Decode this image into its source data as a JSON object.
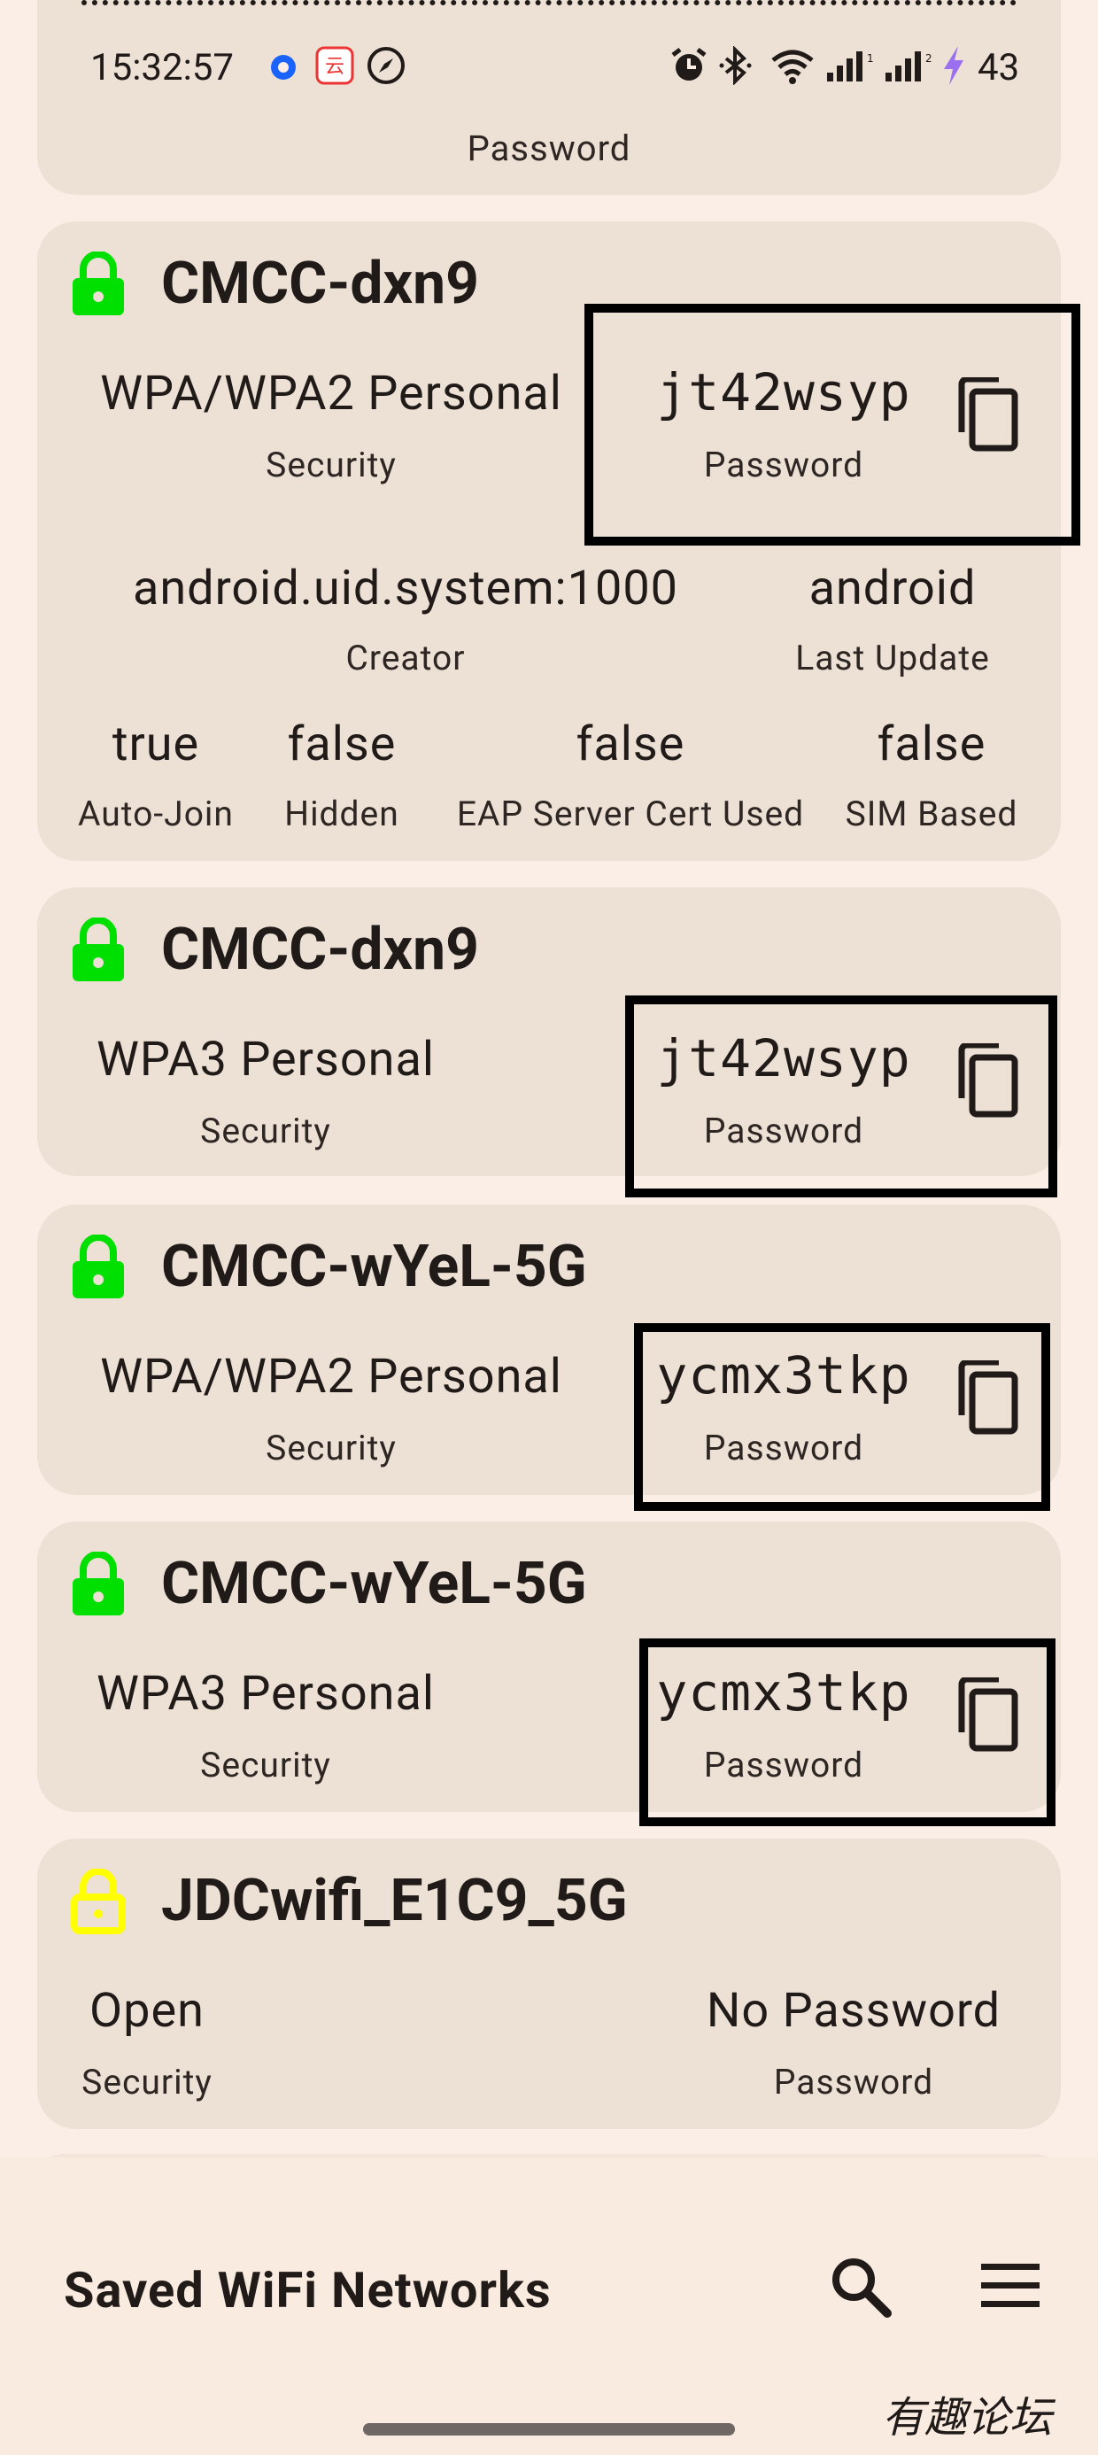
{
  "status_bar": {
    "time": "15:32:57",
    "battery": "43"
  },
  "top_card": {
    "password_label": "Password"
  },
  "networks": [
    {
      "ssid": "CMCC-dxn9",
      "security": "WPA/WPA2 Personal",
      "security_label": "Security",
      "password": "jt42wsyp",
      "password_label": "Password",
      "creator": "android.uid.system:1000",
      "creator_label": "Creator",
      "last_update": "android",
      "last_update_label": "Last Update",
      "auto_join": "true",
      "auto_join_label": "Auto-Join",
      "hidden": "false",
      "hidden_label": "Hidden",
      "eap_cert": "false",
      "eap_cert_label": "EAP Server Cert Used",
      "sim_based": "false",
      "sim_based_label": "SIM Based"
    },
    {
      "ssid": "CMCC-dxn9",
      "security": "WPA3 Personal",
      "security_label": "Security",
      "password": "jt42wsyp",
      "password_label": "Password"
    },
    {
      "ssid": "CMCC-wYeL-5G",
      "security": "WPA/WPA2 Personal",
      "security_label": "Security",
      "password": "ycmx3tkp",
      "password_label": "Password"
    },
    {
      "ssid": "CMCC-wYeL-5G",
      "security": "WPA3 Personal",
      "security_label": "Security",
      "password": "ycmx3tkp",
      "password_label": "Password"
    },
    {
      "ssid": "JDCwifi_E1C9_5G",
      "security": "Open",
      "security_label": "Security",
      "password": "No Password",
      "password_label": "Password"
    }
  ],
  "bottom_bar": {
    "title": "Saved WiFi Networks"
  },
  "watermark": "有趣论坛",
  "colors": {
    "background": "#fbeee6",
    "card": "#ede0d5",
    "lock_secure": "#00e000",
    "lock_open": "#ffff00",
    "highlight_box": "#000000"
  },
  "icons": [
    "lock-icon",
    "lock-open-icon",
    "copy-icon",
    "search-icon",
    "menu-icon",
    "alarm-icon",
    "bluetooth-icon",
    "wifi-icon",
    "signal-icon",
    "charging-icon"
  ]
}
